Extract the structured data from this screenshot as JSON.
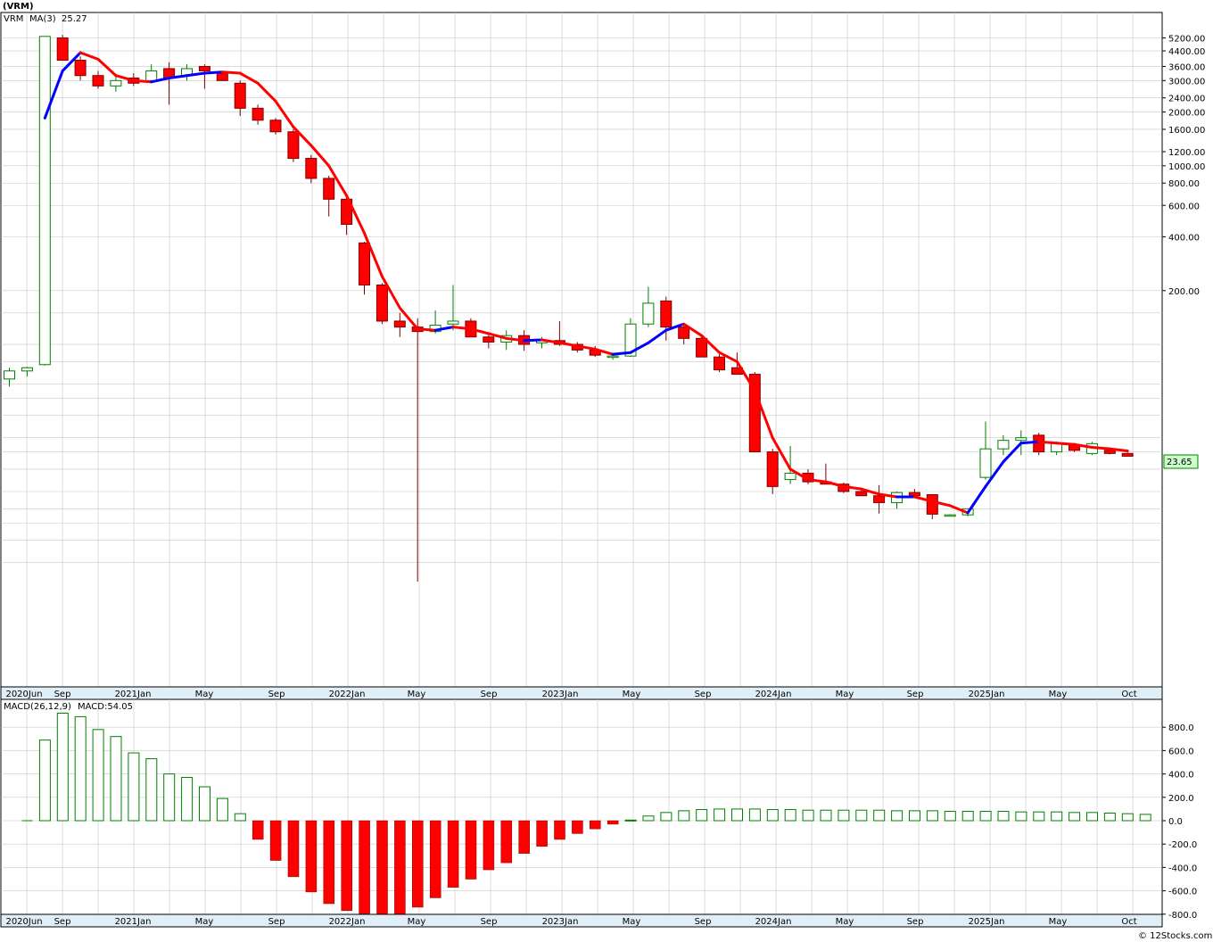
{
  "header": {
    "symbol": "(VRM)",
    "legend_symbol": "VRM",
    "legend_ma": "MA(3)",
    "legend_ma_value": "25.27",
    "last_price": "23.65",
    "macd_label": "MACD(26,12,9)",
    "macd_value": "MACD:54.05",
    "footer": "© 12Stocks.com"
  },
  "colors": {
    "up": "#008000",
    "down": "#ff0000",
    "ma_up": "#0000ff",
    "ma_down": "#ff0000",
    "grid": "#c8c8c8",
    "last_price_bg": "#ccffcc"
  },
  "x_labels": [
    "2020Jun",
    "Sep",
    "2021Jan",
    "May",
    "Sep",
    "2022Jan",
    "May",
    "Sep",
    "2023Jan",
    "May",
    "Sep",
    "2024Jan",
    "May",
    "Sep",
    "2025Jan",
    "May",
    "Oct"
  ],
  "chart_data": [
    {
      "type": "candlestick",
      "title": "(VRM)",
      "scale": "log",
      "y_ticks": [
        "5200.00",
        "4400.00",
        "3600.00",
        "3000.00",
        "2400.00",
        "2000.00",
        "1600.00",
        "1200.00",
        "1000.00",
        "800.00",
        "600.00",
        "400.00",
        "200.00"
      ],
      "ma_label": "MA(3) 25.27",
      "last_price": 23.65,
      "candles": [
        {
          "o": 64,
          "h": 74,
          "l": 58,
          "c": 71
        },
        {
          "o": 71,
          "h": 75,
          "l": 66,
          "c": 74
        },
        {
          "o": 77,
          "h": 5300,
          "l": 76,
          "c": 5300
        },
        {
          "o": 5200,
          "h": 5400,
          "l": 3900,
          "c": 3900
        },
        {
          "o": 3900,
          "h": 4100,
          "l": 3000,
          "c": 3200
        },
        {
          "o": 3200,
          "h": 3400,
          "l": 2700,
          "c": 2800
        },
        {
          "o": 2800,
          "h": 3200,
          "l": 2600,
          "c": 3000
        },
        {
          "o": 3100,
          "h": 3300,
          "l": 2800,
          "c": 2900
        },
        {
          "o": 3000,
          "h": 3700,
          "l": 2900,
          "c": 3400
        },
        {
          "o": 3500,
          "h": 3800,
          "l": 2200,
          "c": 3100
        },
        {
          "o": 3200,
          "h": 3700,
          "l": 3000,
          "c": 3500
        },
        {
          "o": 3600,
          "h": 3700,
          "l": 2700,
          "c": 3400
        },
        {
          "o": 3300,
          "h": 3400,
          "l": 3000,
          "c": 3000
        },
        {
          "o": 2900,
          "h": 3000,
          "l": 1900,
          "c": 2100
        },
        {
          "o": 2100,
          "h": 2200,
          "l": 1700,
          "c": 1800
        },
        {
          "o": 1800,
          "h": 1850,
          "l": 1500,
          "c": 1550
        },
        {
          "o": 1550,
          "h": 1600,
          "l": 1050,
          "c": 1100
        },
        {
          "o": 1100,
          "h": 1150,
          "l": 800,
          "c": 850
        },
        {
          "o": 850,
          "h": 880,
          "l": 520,
          "c": 650
        },
        {
          "o": 650,
          "h": 670,
          "l": 410,
          "c": 470
        },
        {
          "o": 370,
          "h": 375,
          "l": 190,
          "c": 215
        },
        {
          "o": 215,
          "h": 220,
          "l": 130,
          "c": 135
        },
        {
          "o": 135,
          "h": 150,
          "l": 110,
          "c": 125
        },
        {
          "o": 125,
          "h": 140,
          "l": 4.7,
          "c": 118
        },
        {
          "o": 118,
          "h": 155,
          "l": 115,
          "c": 128
        },
        {
          "o": 130,
          "h": 215,
          "l": 120,
          "c": 135
        },
        {
          "o": 135,
          "h": 140,
          "l": 110,
          "c": 110
        },
        {
          "o": 110,
          "h": 115,
          "l": 95,
          "c": 103
        },
        {
          "o": 103,
          "h": 120,
          "l": 93,
          "c": 112
        },
        {
          "o": 112,
          "h": 120,
          "l": 92,
          "c": 100
        },
        {
          "o": 102,
          "h": 110,
          "l": 95,
          "c": 105
        },
        {
          "o": 105,
          "h": 135,
          "l": 98,
          "c": 100
        },
        {
          "o": 100,
          "h": 103,
          "l": 90,
          "c": 93
        },
        {
          "o": 93,
          "h": 98,
          "l": 85,
          "c": 87
        },
        {
          "o": 85,
          "h": 88,
          "l": 82,
          "c": 86
        },
        {
          "o": 86,
          "h": 140,
          "l": 85,
          "c": 130
        },
        {
          "o": 130,
          "h": 210,
          "l": 125,
          "c": 170
        },
        {
          "o": 175,
          "h": 185,
          "l": 105,
          "c": 125
        },
        {
          "o": 125,
          "h": 130,
          "l": 100,
          "c": 108
        },
        {
          "o": 108,
          "h": 112,
          "l": 85,
          "c": 85
        },
        {
          "o": 85,
          "h": 88,
          "l": 70,
          "c": 72
        },
        {
          "o": 74,
          "h": 90,
          "l": 68,
          "c": 68
        },
        {
          "o": 68,
          "h": 70,
          "l": 25,
          "c": 25
        },
        {
          "o": 25,
          "h": 26,
          "l": 14.5,
          "c": 16
        },
        {
          "o": 17.5,
          "h": 27,
          "l": 16.5,
          "c": 19
        },
        {
          "o": 19,
          "h": 20,
          "l": 16.5,
          "c": 17
        },
        {
          "o": 17,
          "h": 21.5,
          "l": 16.5,
          "c": 16.5
        },
        {
          "o": 16.5,
          "h": 16.8,
          "l": 14.7,
          "c": 15
        },
        {
          "o": 15,
          "h": 15.5,
          "l": 14.2,
          "c": 14.2
        },
        {
          "o": 14.2,
          "h": 16.3,
          "l": 11.3,
          "c": 13
        },
        {
          "o": 13,
          "h": 15,
          "l": 12,
          "c": 14.8
        },
        {
          "o": 14.8,
          "h": 15.5,
          "l": 14,
          "c": 14.2
        },
        {
          "o": 14.4,
          "h": 14.5,
          "l": 10.5,
          "c": 11.2
        },
        {
          "o": 11,
          "h": 11.2,
          "l": 10.9,
          "c": 11.1
        },
        {
          "o": 11.1,
          "h": 12,
          "l": 10.9,
          "c": 12
        },
        {
          "o": 18,
          "h": 37,
          "l": 17.5,
          "c": 26
        },
        {
          "o": 26,
          "h": 31,
          "l": 24,
          "c": 29
        },
        {
          "o": 29,
          "h": 33,
          "l": 24,
          "c": 30
        },
        {
          "o": 31,
          "h": 32,
          "l": 24,
          "c": 25
        },
        {
          "o": 25,
          "h": 28.5,
          "l": 24,
          "c": 28
        },
        {
          "o": 27.5,
          "h": 28,
          "l": 25,
          "c": 25.5
        },
        {
          "o": 24.5,
          "h": 28.5,
          "l": 24,
          "c": 27.8
        },
        {
          "o": 25.5,
          "h": 26,
          "l": 24.2,
          "c": 24.5
        },
        {
          "o": 24.5,
          "h": 24.8,
          "l": 23.6,
          "c": 23.65
        }
      ],
      "ma3": [
        null,
        null,
        1850,
        3400,
        4300,
        3950,
        3200,
        3000,
        2950,
        3100,
        3200,
        3300,
        3350,
        3300,
        2900,
        2300,
        1650,
        1300,
        1000,
        680,
        420,
        240,
        160,
        122,
        120,
        125,
        122,
        115,
        108,
        105,
        106,
        102,
        98,
        94,
        88,
        90,
        102,
        120,
        130,
        112,
        90,
        80,
        55,
        30,
        20,
        17.5,
        17,
        16,
        15.5,
        14.5,
        14,
        14,
        13.2,
        12.5,
        11.4,
        16,
        22,
        28,
        28.5,
        28,
        27.5,
        26.5,
        26,
        25.3
      ]
    },
    {
      "type": "bar",
      "title": "MACD(26,12,9)",
      "value_label": "MACD:54.05",
      "y_ticks": [
        "800.0",
        "600.0",
        "400.0",
        "200.0",
        "0.0",
        "-200.0",
        "-400.0",
        "-600.0",
        "-800.0"
      ],
      "ylim": [
        -800,
        1000
      ],
      "values": [
        0,
        690,
        920,
        890,
        780,
        720,
        580,
        530,
        400,
        370,
        290,
        190,
        60,
        -160,
        -340,
        -480,
        -610,
        -710,
        -770,
        -795,
        -800,
        -800,
        -740,
        -660,
        -570,
        -500,
        -420,
        -360,
        -280,
        -220,
        -160,
        -110,
        -70,
        -30,
        5,
        40,
        70,
        85,
        95,
        100,
        100,
        100,
        95,
        95,
        90,
        90,
        90,
        90,
        90,
        85,
        85,
        85,
        80,
        80,
        80,
        80,
        75,
        75,
        75,
        70,
        70,
        65,
        60,
        54.05
      ]
    }
  ]
}
